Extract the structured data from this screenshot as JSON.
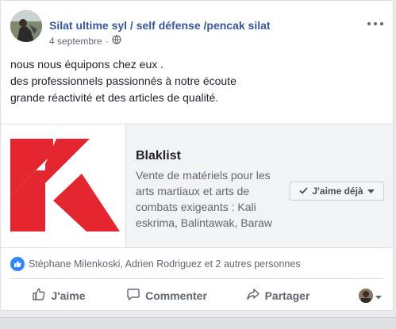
{
  "post": {
    "author": "Silat ultime syl / self défense /pencak silat",
    "date": "4 septembre",
    "audience_icon": "globe-icon",
    "menu_icon": "more-dots-icon",
    "text_lines": [
      "nous nous équipons chez eux .",
      "des professionnels passionnés à notre écoute",
      "grande réactivité et des articles de qualité."
    ]
  },
  "link": {
    "title": "Blaklist",
    "description": "Vente de matériels pour les arts martiaux et arts de combats exigeants : Kali eskrima, Balintawak, Baraw",
    "like_button": "J'aime déjà",
    "logo_color": "#e3262f"
  },
  "reactions": {
    "icon": "like-reaction-icon",
    "text": "Stéphane Milenkoski, Adrien Rodriguez et 2 autres personnes"
  },
  "actions": {
    "like": "J'aime",
    "comment": "Commenter",
    "share": "Partager"
  },
  "colors": {
    "link_blue": "#365899",
    "like_blue": "#2d88ff",
    "text_gray": "#606770"
  }
}
